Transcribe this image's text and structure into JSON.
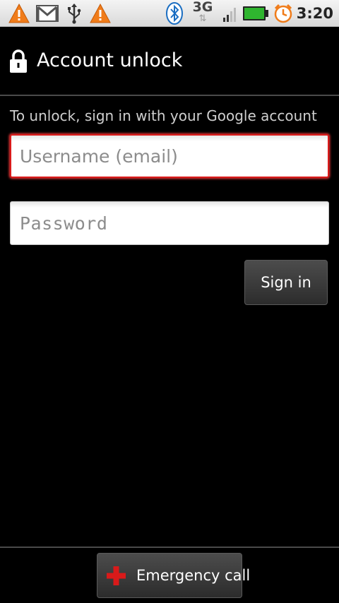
{
  "status_bar": {
    "icons": [
      "warning-icon",
      "gmail-icon",
      "usb-icon",
      "warning-icon",
      "bluetooth-icon",
      "network-3g-icon",
      "signal-icon",
      "battery-icon",
      "alarm-icon"
    ],
    "network_type": "3G",
    "network_activity": "⇅",
    "time": "3:20",
    "colors": {
      "warning": "#f07c1a",
      "battery": "#2fb52f",
      "bluetooth": "#1b6ec2",
      "alarm": "#f07c1a"
    }
  },
  "header": {
    "title": "Account unlock",
    "icon": "lock-icon"
  },
  "form": {
    "instruction": "To unlock, sign in with your Google account",
    "username_placeholder": "Username (email)",
    "username_value": "",
    "password_placeholder": "Password",
    "password_value": "",
    "sign_in_label": "Sign in"
  },
  "footer": {
    "emergency_label": "Emergency call",
    "emergency_icon": "red-cross-icon",
    "accent": "#d91a1a"
  }
}
